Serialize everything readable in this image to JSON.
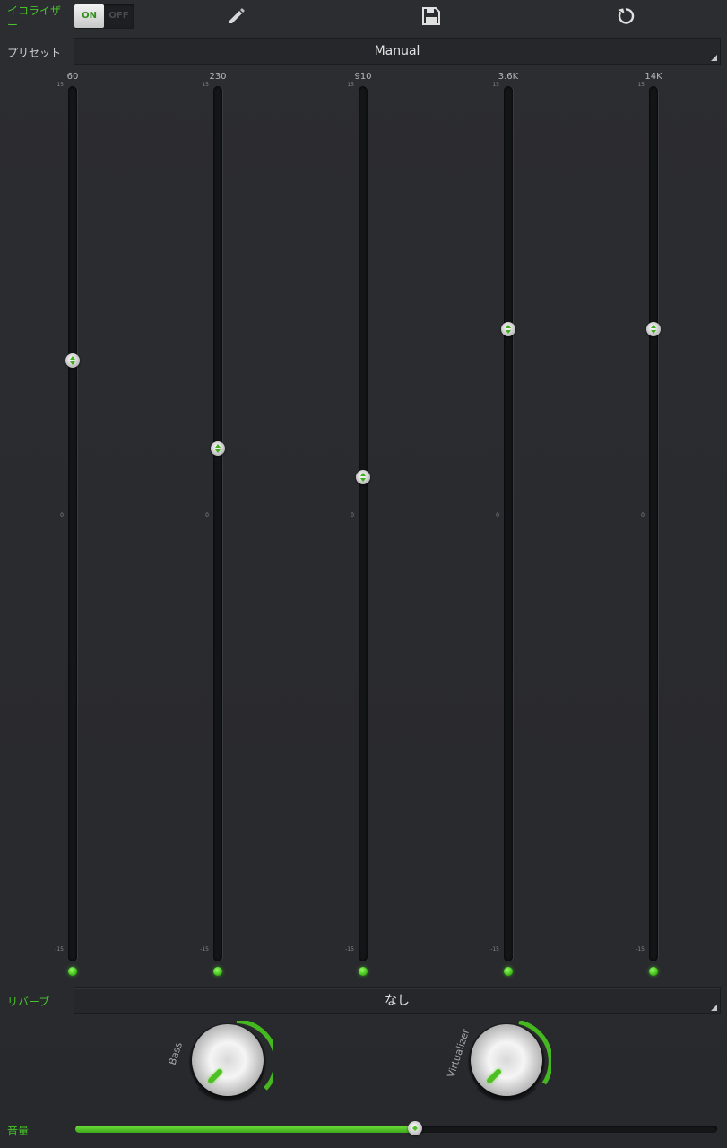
{
  "equalizer": {
    "label": "イコライザー",
    "toggle_on": "ON",
    "toggle_off": "OFF",
    "enabled": true
  },
  "toolbar": {
    "edit_icon": "pencil-icon",
    "save_icon": "save-icon",
    "reset_icon": "reset-icon"
  },
  "preset": {
    "label": "プリセット",
    "value": "Manual"
  },
  "scale": {
    "max": "15",
    "mid": "0",
    "min": "-15"
  },
  "bands": [
    {
      "freq": "60",
      "level": 6.2
    },
    {
      "freq": "230",
      "level": 3.2
    },
    {
      "freq": "910",
      "level": 2.2
    },
    {
      "freq": "3.6K",
      "level": 7.3
    },
    {
      "freq": "14K",
      "level": 7.3
    }
  ],
  "reverb": {
    "label": "リバーブ",
    "value": "なし"
  },
  "knobs": {
    "bass_label": "Bass",
    "virtualizer_label": "Virtualizer"
  },
  "volume": {
    "label": "音量",
    "level": 0.53
  },
  "colors": {
    "accent": "#47c42a",
    "background": "#2b2c30"
  }
}
